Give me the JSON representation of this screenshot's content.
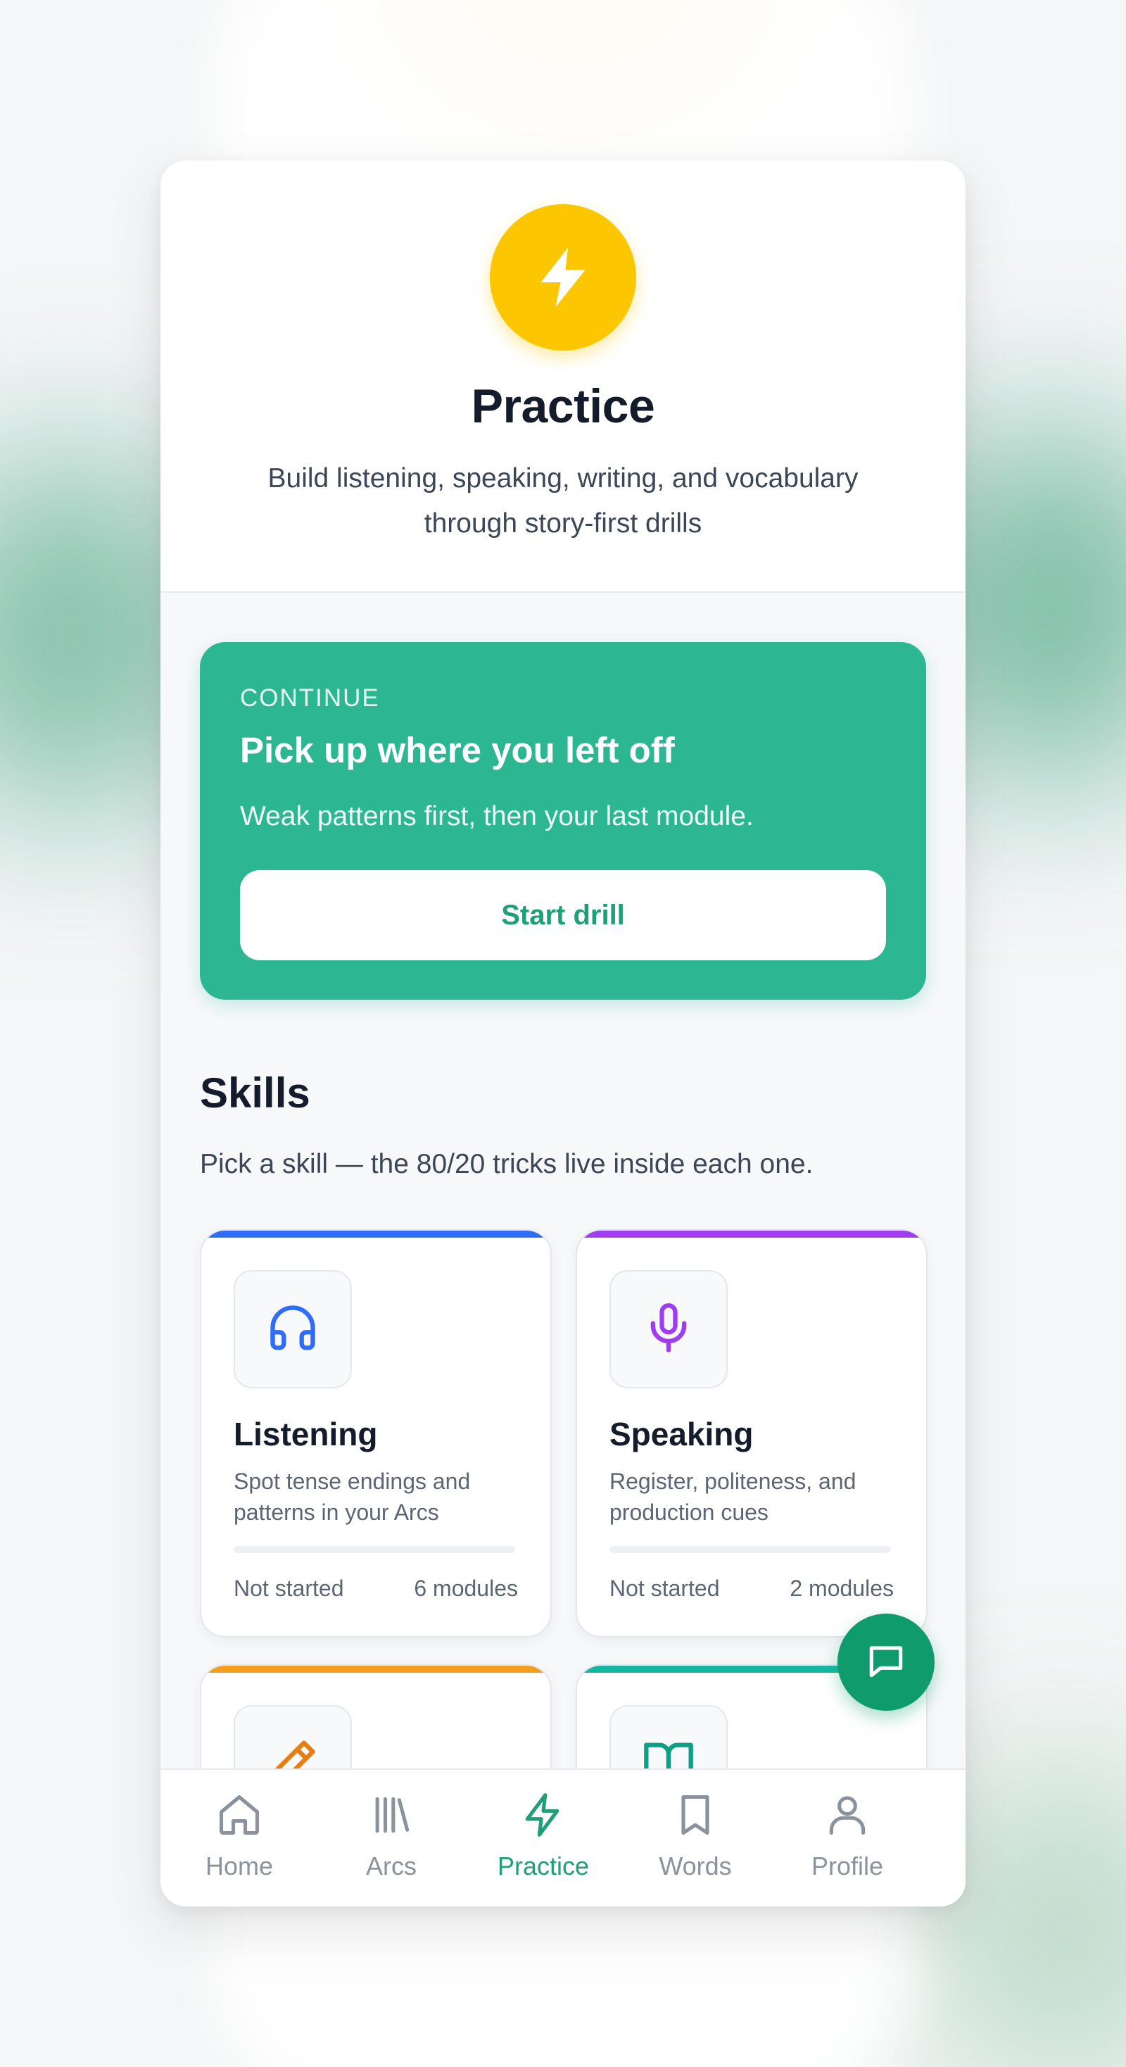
{
  "header": {
    "title": "Practice",
    "subtitle": "Build listening, speaking, writing, and vocabulary through story-first drills",
    "icon": "lightning-bolt-icon",
    "icon_color": "#fcc700"
  },
  "continue_card": {
    "eyebrow": "CONTINUE",
    "title": "Pick up where you left off",
    "description": "Weak patterns first, then your last module.",
    "button_label": "Start drill",
    "color": "#2db692"
  },
  "skills": {
    "title": "Skills",
    "subtitle": "Pick a skill — the 80/20 tricks live inside each one.",
    "items": [
      {
        "name": "Listening",
        "description": "Spot tense endings and patterns in your Arcs",
        "status": "Not started",
        "modules": "6 modules",
        "progress": 0,
        "accent": "#2f6df6",
        "icon": "headphones-icon"
      },
      {
        "name": "Speaking",
        "description": "Register, politeness, and production cues",
        "status": "Not started",
        "modules": "2 modules",
        "progress": 0,
        "accent": "#a13df0",
        "icon": "microphone-icon"
      },
      {
        "name": "",
        "description": "",
        "status": "",
        "modules": "",
        "progress": 0,
        "accent": "#f59e1b",
        "icon": "pencil-icon"
      },
      {
        "name": "",
        "description": "",
        "status": "",
        "modules": "",
        "progress": 0,
        "accent": "#14b8a0",
        "icon": "book-icon"
      }
    ]
  },
  "nav": {
    "items": [
      {
        "label": "Home",
        "icon": "home-icon"
      },
      {
        "label": "Arcs",
        "icon": "library-icon"
      },
      {
        "label": "Practice",
        "icon": "lightning-bolt-icon",
        "active": true
      },
      {
        "label": "Words",
        "icon": "bookmark-icon"
      },
      {
        "label": "Profile",
        "icon": "user-icon"
      }
    ],
    "active_color": "#1f9f78",
    "inactive_color": "#8a929e"
  },
  "fab": {
    "icon": "chat-bubble-icon",
    "color": "#0f9b6c"
  }
}
